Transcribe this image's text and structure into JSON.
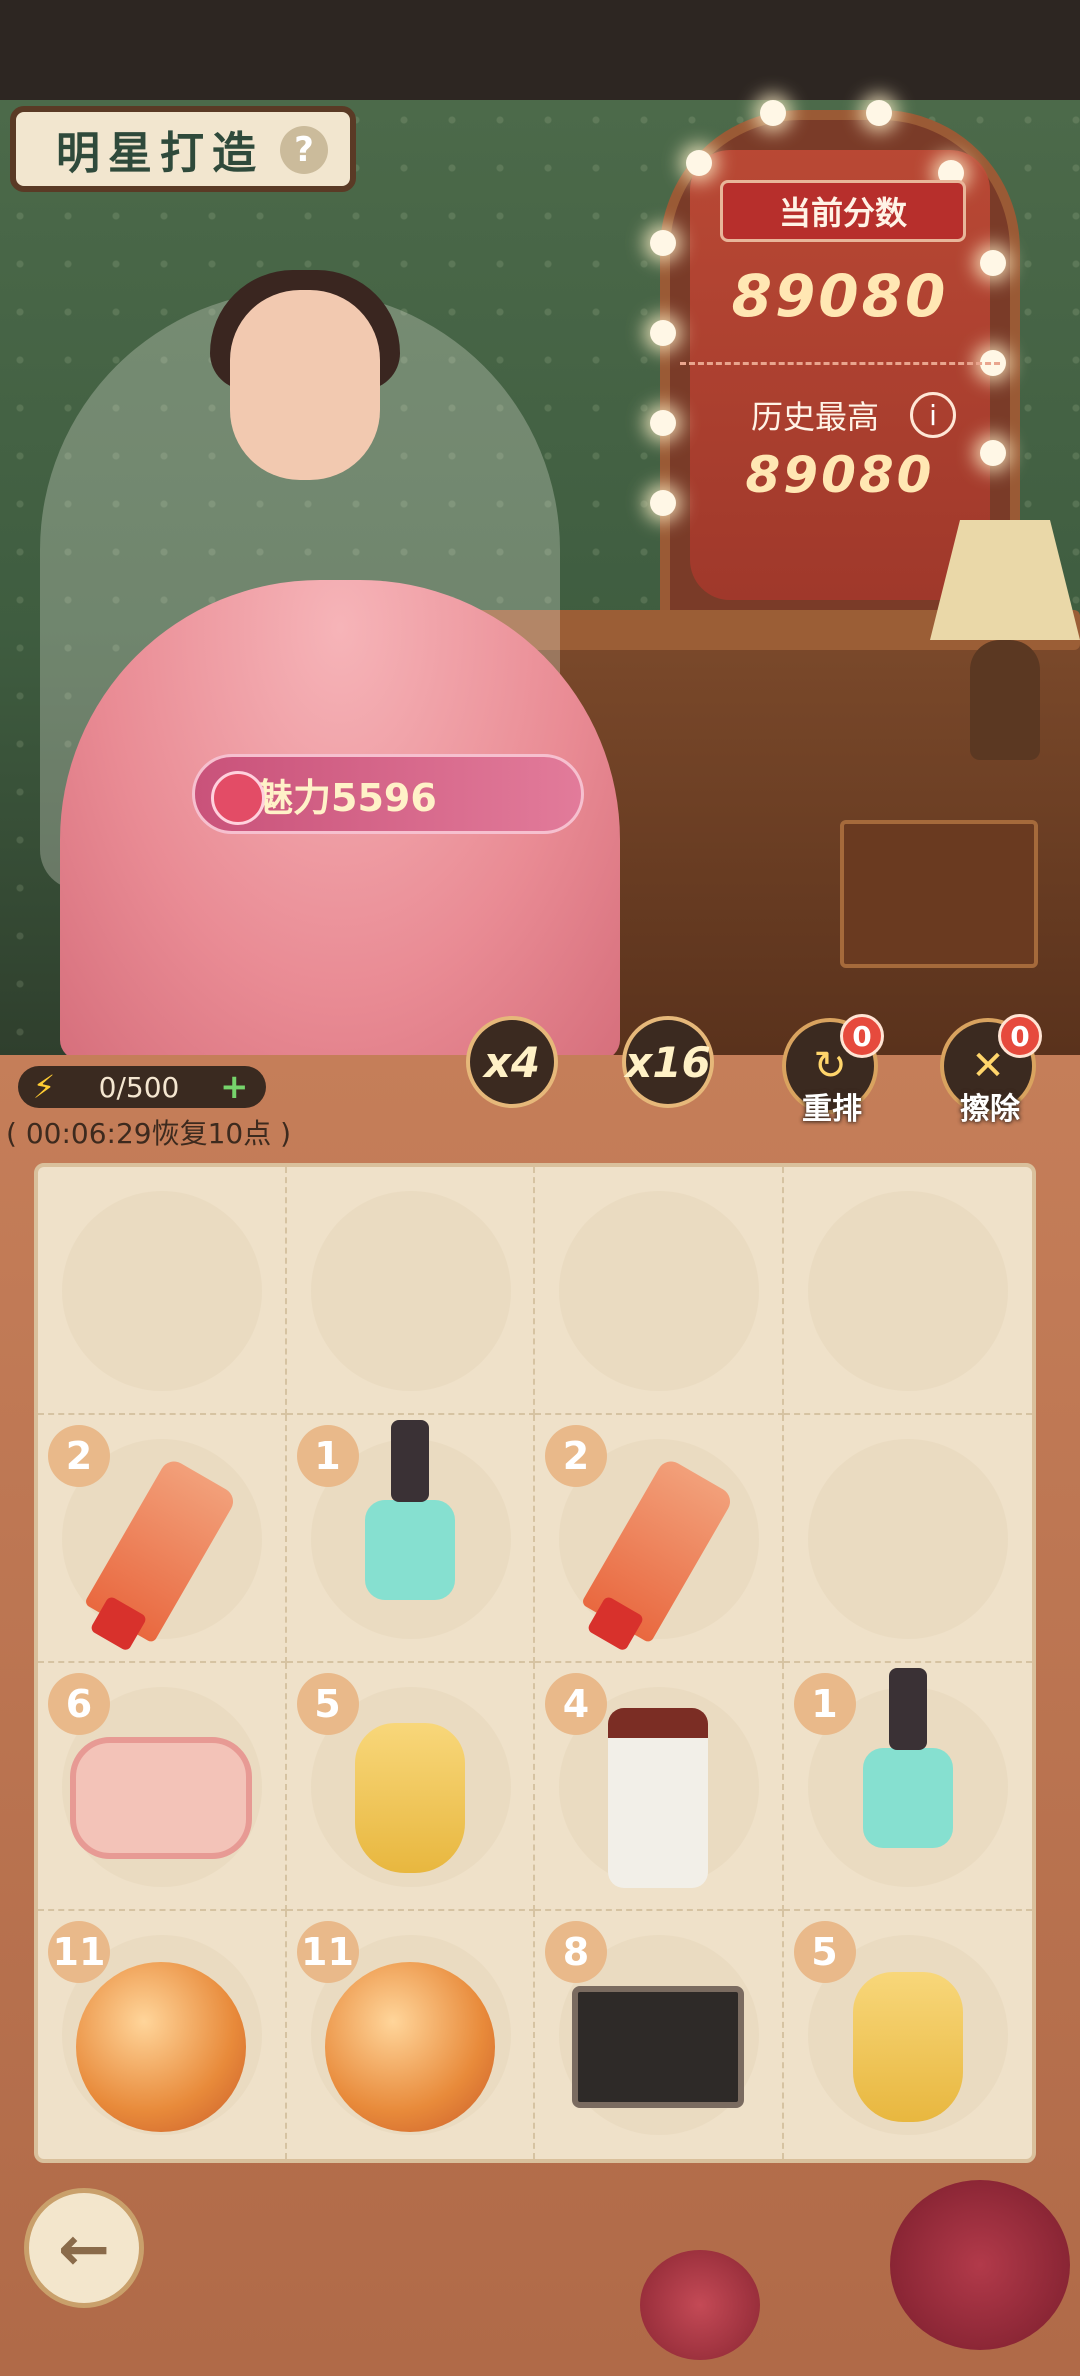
{
  "title": "明星打造",
  "help_icon": "?",
  "score": {
    "label": "当前分数",
    "current": "89080",
    "best_label": "历史最高",
    "best": "89080",
    "info_icon": "i"
  },
  "charm": {
    "label": "魅力5596"
  },
  "energy": {
    "value": "0/500",
    "recover": "( 00:06:29恢复10点 )"
  },
  "multipliers": [
    "x4",
    "x16"
  ],
  "tools": [
    {
      "label": "重排",
      "count": "0"
    },
    {
      "label": "擦除",
      "count": "0"
    }
  ],
  "board": [
    [
      null,
      null,
      null,
      null
    ],
    [
      {
        "level": "2",
        "item": "hand-cream"
      },
      {
        "level": "1",
        "item": "nail-polish"
      },
      {
        "level": "2",
        "item": "hand-cream"
      },
      null
    ],
    [
      {
        "level": "6",
        "item": "powder-compact"
      },
      {
        "level": "5",
        "item": "hair-oil-bottle"
      },
      {
        "level": "4",
        "item": "cream-jar"
      },
      {
        "level": "1",
        "item": "nail-polish"
      }
    ],
    [
      {
        "level": "11",
        "item": "perfume-bottle"
      },
      {
        "level": "11",
        "item": "perfume-bottle"
      },
      {
        "level": "8",
        "item": "eyeshadow-palette"
      },
      {
        "level": "5",
        "item": "hair-oil-bottle"
      }
    ]
  ],
  "back_icon": "back-arrow-icon",
  "colors": {
    "accent": "#b72f2c",
    "panel": "#c57e59",
    "board": "#efe1c9"
  }
}
